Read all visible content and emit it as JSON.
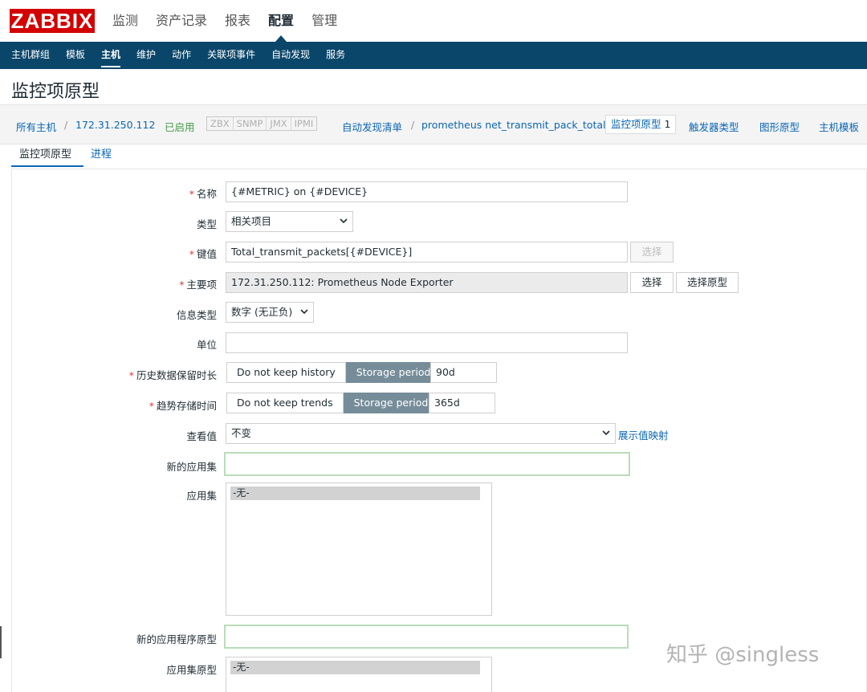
{
  "logo": "ZABBIX",
  "topnav": [
    "监测",
    "资产记录",
    "报表",
    "配置",
    "管理"
  ],
  "subnav": [
    "主机群组",
    "模板",
    "主机",
    "维护",
    "动作",
    "关联项事件",
    "自动发现",
    "服务"
  ],
  "page_title": "监控项原型",
  "breadcrumb": {
    "all_hosts": "所有主机",
    "sep1": "/",
    "host": "172.31.250.112",
    "status": "已启用",
    "availability": [
      "ZBX",
      "SNMP",
      "JMX",
      "IPMI"
    ],
    "discovery_list": "自动发现清单",
    "sep2": "/",
    "discovery_rule": "prometheus net_transmit_pack_total",
    "item_prototypes": "监控项原型",
    "item_prototypes_count": "1",
    "trigger_types": "触发器类型",
    "graph_prototypes": "图形原型",
    "host_templates": "主机模板"
  },
  "tabs": [
    "监控项原型",
    "进程"
  ],
  "form": {
    "name_label": "名称",
    "name_value": "{#METRIC} on {#DEVICE}",
    "type_label": "类型",
    "type_value": "相关项目",
    "key_label": "键值",
    "key_value": "Total_transmit_packets[{#DEVICE}]",
    "key_select": "选择",
    "master_label": "主要项",
    "master_value": "172.31.250.112: Prometheus Node Exporter",
    "master_select": "选择",
    "master_select_prototype": "选择原型",
    "info_type_label": "信息类型",
    "info_type_value": "数字 (无正负)",
    "units_label": "单位",
    "units_value": "",
    "history_label": "历史数据保留时长",
    "history_opt1": "Do not keep history",
    "history_opt2": "Storage period",
    "history_value": "90d",
    "trends_label": "趋势存储时间",
    "trends_opt1": "Do not keep trends",
    "trends_opt2": "Storage period",
    "trends_value": "365d",
    "valuemap_label": "查看值",
    "valuemap_value": "不变",
    "valuemap_link": "展示值映射",
    "new_app_label": "新的应用集",
    "new_app_value": "",
    "apps_label": "应用集",
    "apps_items": [
      "-无-"
    ],
    "new_app_proto_label": "新的应用程序原型",
    "new_app_proto_value": "",
    "app_proto_label": "应用集原型",
    "app_proto_items": [
      "-无-"
    ]
  },
  "watermark": "知乎 @singless",
  "colors": {
    "brand_red": "#d40000",
    "nav_blue": "#0a466a",
    "link_blue": "#0a66b3",
    "enabled_green": "#429e47",
    "segment_active": "#768d99",
    "required_red": "#e33734"
  }
}
